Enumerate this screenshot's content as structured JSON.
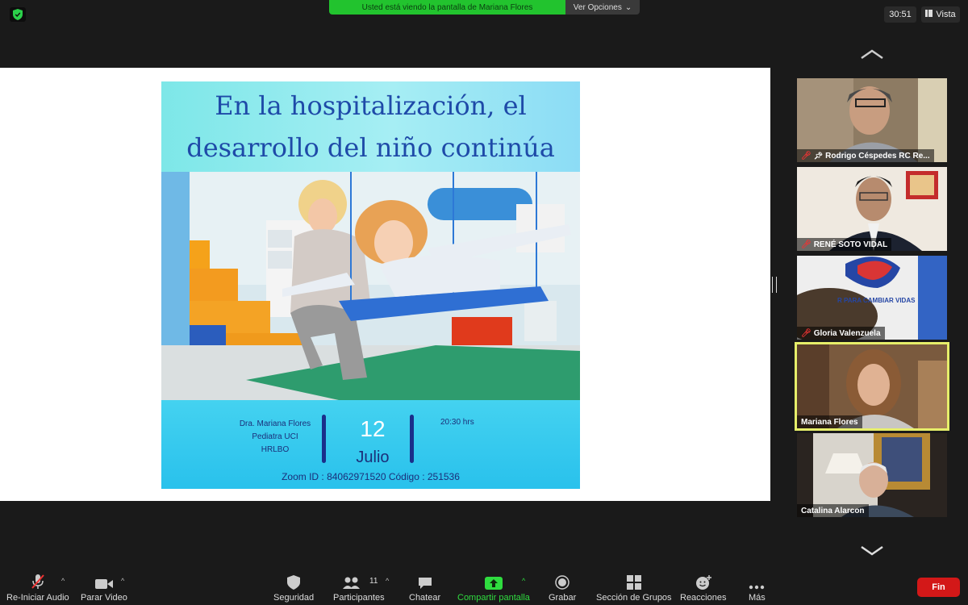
{
  "top": {
    "share_notice": "Usted está viendo la pantalla de Mariana Flores",
    "view_options": "Ver Opciones",
    "timer": "30:51",
    "view_label": "Vista"
  },
  "poster": {
    "title_line1": "En la hospitalización, el",
    "title_line2": "desarrollo del niño continúa",
    "doctor_line1": "Dra. Mariana Flores",
    "doctor_line2": "Pediatra  UCI",
    "doctor_line3": "HRLBO",
    "day": "12",
    "month": "Julio",
    "time": "20:30  hrs",
    "zoom_info": "Zoom ID : 84062971520   Código : 251536"
  },
  "participants": [
    {
      "name": "Rodrigo Céspedes RC Re...",
      "muted": true,
      "pinned": true
    },
    {
      "name": "RENÉ SOTO VIDAL",
      "muted": true,
      "pinned": false
    },
    {
      "name": "Gloria Valenzuela",
      "muted": true,
      "pinned": false,
      "banner_text": "R PARA CAMBIAR VIDAS"
    },
    {
      "name": "Mariana Flores",
      "muted": false,
      "pinned": false,
      "active_speaker": true
    },
    {
      "name": "Catalina Alarcon",
      "muted": false,
      "pinned": false
    }
  ],
  "toolbar": {
    "audio": "Re-Iniciar Audio",
    "video": "Parar Video",
    "security": "Seguridad",
    "participants": "Participantes",
    "participants_count": "11",
    "chat": "Chatear",
    "share": "Compartir pantalla",
    "record": "Grabar",
    "breakout": "Sección de Grupos",
    "reactions": "Reacciones",
    "more": "Más",
    "end": "Fin"
  },
  "colors": {
    "share_green": "#22c32e",
    "end_red": "#d31818",
    "active_speaker": "#e6ee6a"
  }
}
